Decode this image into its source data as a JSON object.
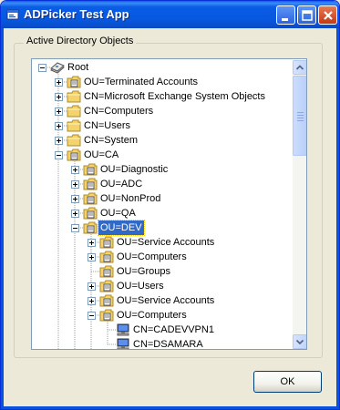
{
  "window": {
    "title": "ADPicker Test App"
  },
  "group": {
    "label": "Active Directory Objects"
  },
  "tree": {
    "nodes": [
      {
        "label": "Root",
        "icon": "root-icon",
        "level": 0,
        "expander": "minus"
      },
      {
        "label": "OU=Terminated Accounts",
        "icon": "ou-folder-icon",
        "level": 1,
        "expander": "plus"
      },
      {
        "label": "CN=Microsoft Exchange System Objects",
        "icon": "folder-icon",
        "level": 1,
        "expander": "plus"
      },
      {
        "label": "CN=Computers",
        "icon": "folder-icon",
        "level": 1,
        "expander": "plus"
      },
      {
        "label": "CN=Users",
        "icon": "folder-icon",
        "level": 1,
        "expander": "plus"
      },
      {
        "label": "CN=System",
        "icon": "folder-icon",
        "level": 1,
        "expander": "plus"
      },
      {
        "label": "OU=CA",
        "icon": "ou-folder-icon",
        "level": 1,
        "expander": "minus"
      },
      {
        "label": "OU=Diagnostic",
        "icon": "ou-folder-icon",
        "level": 2,
        "expander": "plus"
      },
      {
        "label": "OU=ADC",
        "icon": "ou-folder-icon",
        "level": 2,
        "expander": "plus"
      },
      {
        "label": "OU=NonProd",
        "icon": "ou-folder-icon",
        "level": 2,
        "expander": "plus"
      },
      {
        "label": "OU=QA",
        "icon": "ou-folder-icon",
        "level": 2,
        "expander": "plus"
      },
      {
        "label": "OU=DEV",
        "icon": "ou-folder-icon",
        "level": 2,
        "expander": "minus",
        "selected": true
      },
      {
        "label": "OU=Service Accounts",
        "icon": "ou-folder-icon",
        "level": 3,
        "expander": "plus"
      },
      {
        "label": "OU=Computers",
        "icon": "ou-folder-icon",
        "level": 3,
        "expander": "plus"
      },
      {
        "label": "OU=Groups",
        "icon": "ou-folder-icon",
        "level": 3,
        "expander": "none"
      },
      {
        "label": "OU=Users",
        "icon": "ou-folder-icon",
        "level": 3,
        "expander": "plus"
      },
      {
        "label": "OU=Service Accounts",
        "icon": "ou-folder-icon",
        "level": 3,
        "expander": "plus"
      },
      {
        "label": "OU=Computers",
        "icon": "ou-folder-icon",
        "level": 3,
        "expander": "minus"
      },
      {
        "label": "CN=CADEVVPN1",
        "icon": "computer-icon",
        "level": 4,
        "expander": "none"
      },
      {
        "label": "CN=DSAMARA",
        "icon": "computer-icon",
        "level": 4,
        "expander": "none"
      }
    ]
  },
  "buttons": {
    "ok_label": "OK"
  },
  "colors": {
    "title_bar": "#0757df",
    "selection": "#316ac5",
    "folder": "#f3d36b",
    "window_bg": "#ece9d8"
  }
}
